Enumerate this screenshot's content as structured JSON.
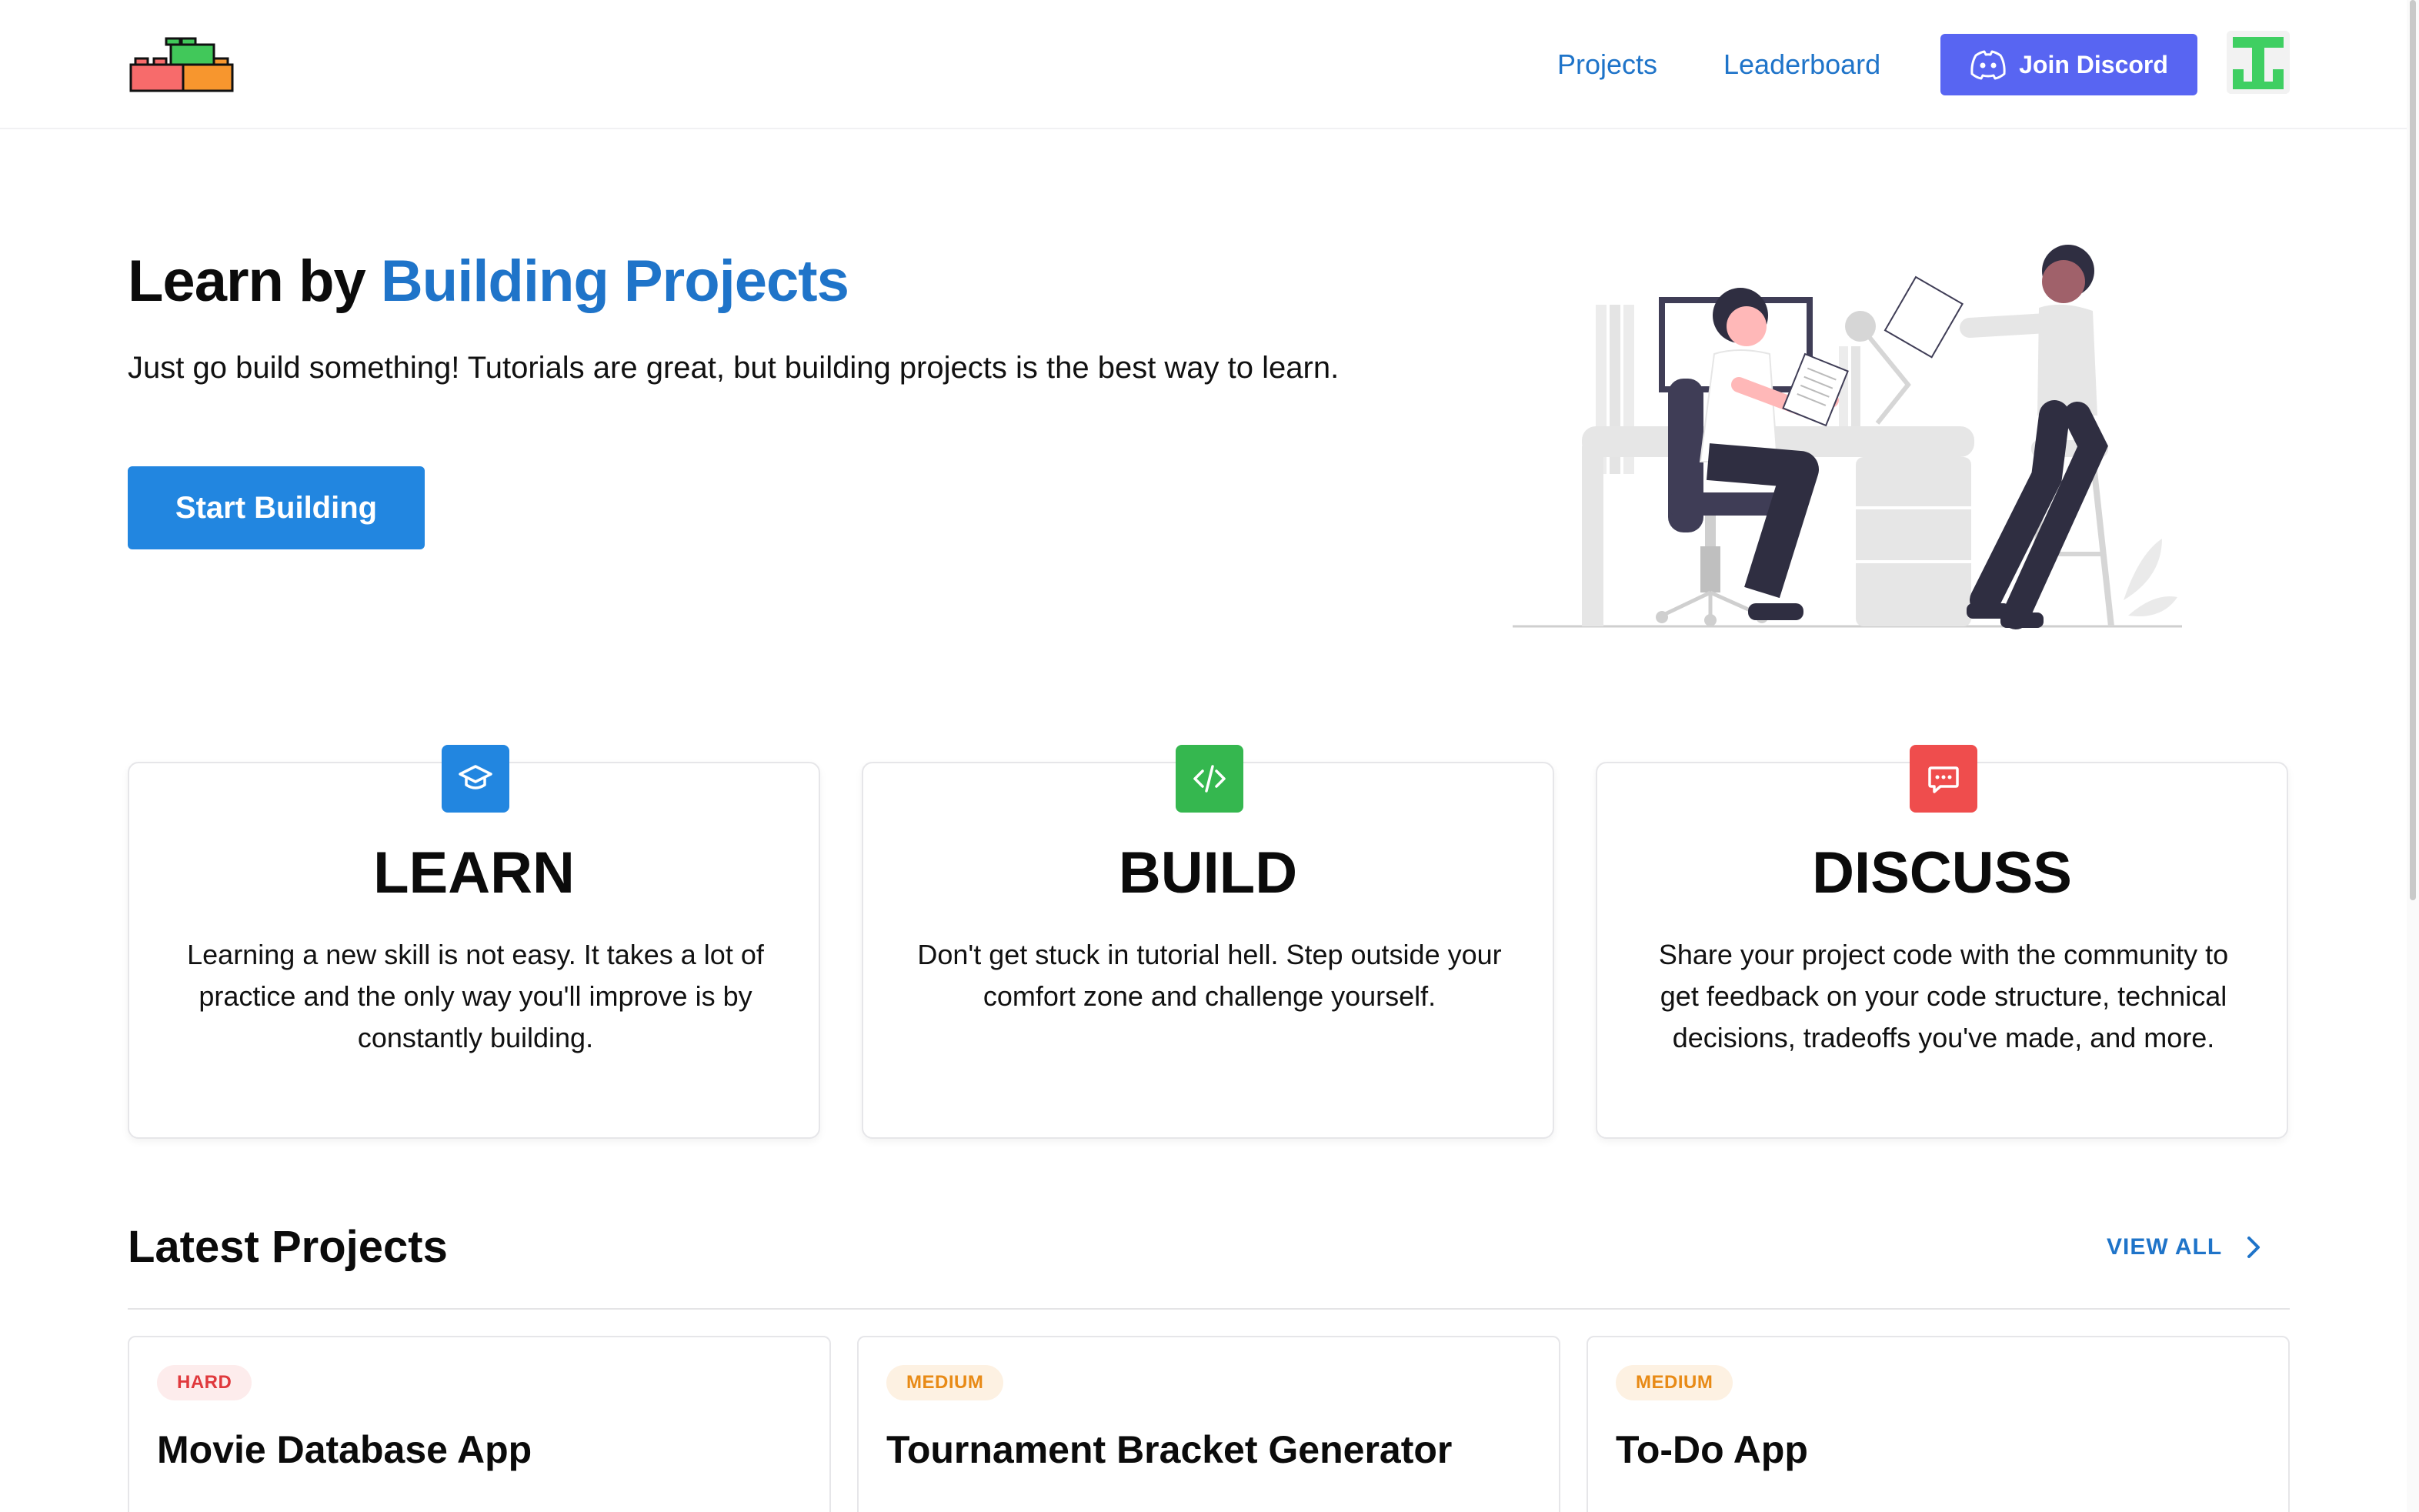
{
  "header": {
    "nav": [
      {
        "label": "Projects"
      },
      {
        "label": "Leaderboard"
      }
    ],
    "discord_button": "Join Discord"
  },
  "hero": {
    "title_plain": "Learn by ",
    "title_accent": "Building Projects",
    "subtitle": "Just go build something! Tutorials are great, but building projects is the best way to learn.",
    "cta": "Start Building"
  },
  "features": [
    {
      "title": "LEARN",
      "icon": "graduation-cap-icon",
      "color": "#2286e0",
      "text": "Learning a new skill is not easy. It takes a lot of practice and the only way you'll improve is by constantly building."
    },
    {
      "title": "BUILD",
      "icon": "code-icon",
      "color": "#35b74f",
      "text": "Don't get stuck in tutorial hell. Step outside your comfort zone and challenge yourself."
    },
    {
      "title": "DISCUSS",
      "icon": "chat-icon",
      "color": "#ef4d4d",
      "text": "Share your project code with the community to get feedback on your code structure, technical decisions, tradeoffs you've made, and more."
    }
  ],
  "latest_projects": {
    "title": "Latest Projects",
    "view_all": "VIEW ALL",
    "items": [
      {
        "difficulty": "HARD",
        "title": "Movie Database App"
      },
      {
        "difficulty": "MEDIUM",
        "title": "Tournament Bracket Generator"
      },
      {
        "difficulty": "MEDIUM",
        "title": "To-Do App"
      }
    ]
  },
  "colors": {
    "brand_blue": "#1f74c9",
    "cta_blue": "#2286e0",
    "discord": "#5865f2",
    "hard": "#e0393d",
    "medium": "#e88a16"
  }
}
